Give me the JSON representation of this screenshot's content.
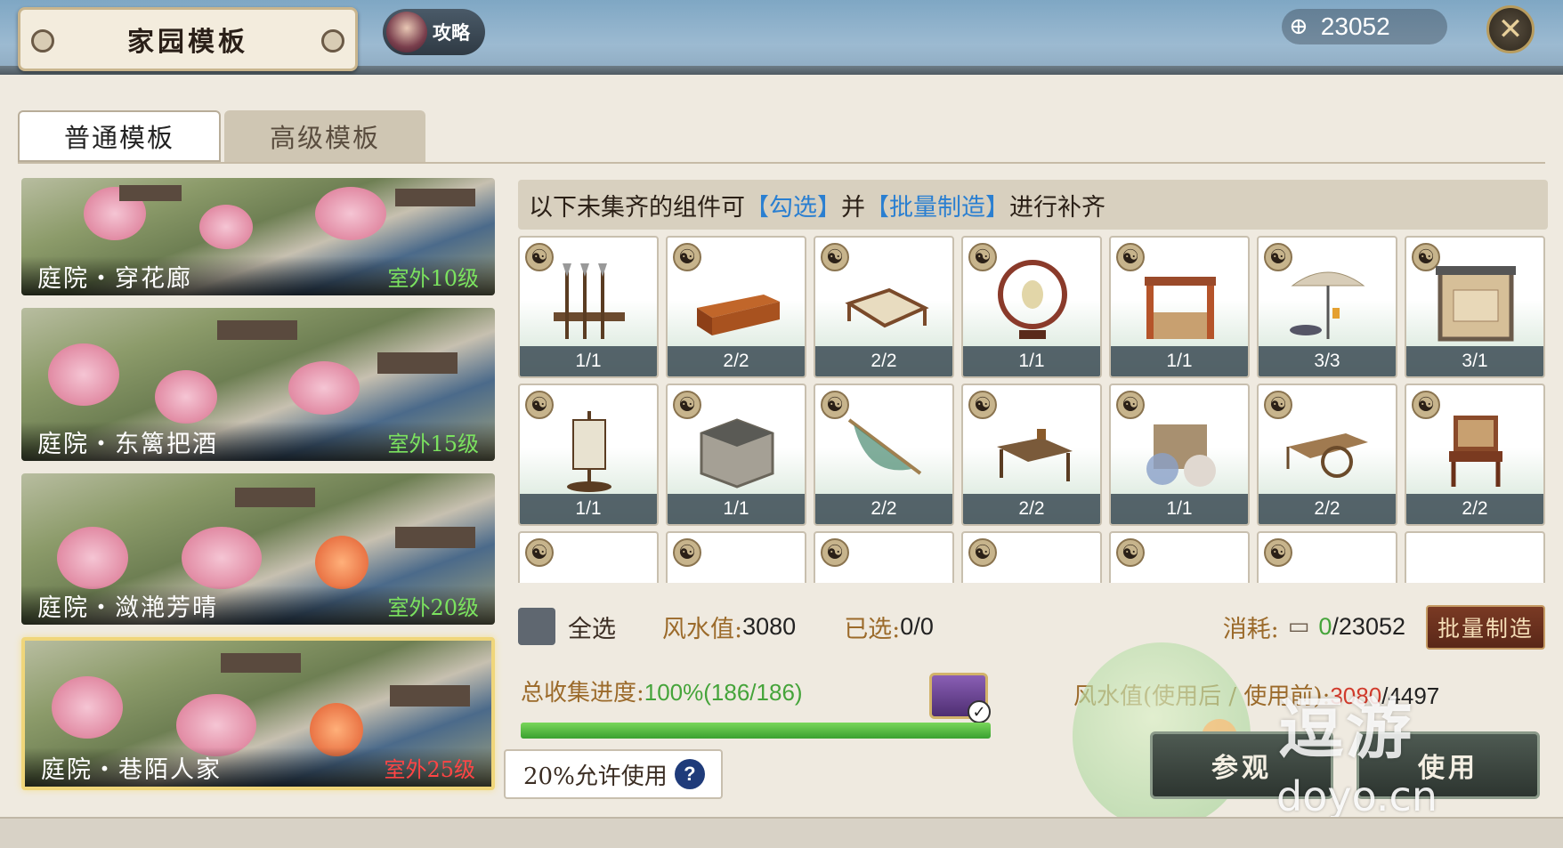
{
  "header": {
    "title": "家园模板",
    "guide_label": "攻略",
    "coins": "23052"
  },
  "tabs": [
    {
      "label": "普通模板"
    },
    {
      "label": "高级模板"
    }
  ],
  "templates": [
    {
      "name": "庭院・穿花廊",
      "level": "室外10级"
    },
    {
      "name": "庭院・东篱把酒",
      "level": "室外15级"
    },
    {
      "name": "庭院・潋滟芳晴",
      "level": "室外20级"
    },
    {
      "name": "庭院・巷陌人家",
      "level": "室外25级"
    }
  ],
  "hint": {
    "pre": "以下未集齐的组件可",
    "link1": "【勾选】",
    "mid": "并",
    "link2": "【批量制造】",
    "post": "进行补齐"
  },
  "items": [
    {
      "count": "1/1",
      "icon": "weapon-rack-icon"
    },
    {
      "count": "2/2",
      "icon": "cabinet-icon"
    },
    {
      "count": "2/2",
      "icon": "bed-icon"
    },
    {
      "count": "1/1",
      "icon": "lantern-ring-icon"
    },
    {
      "count": "1/1",
      "icon": "stall-icon"
    },
    {
      "count": "3/3",
      "icon": "umbrella-icon"
    },
    {
      "count": "3/1",
      "icon": "screen-wall-icon"
    },
    {
      "count": "1/1",
      "icon": "banner-stand-icon"
    },
    {
      "count": "1/1",
      "icon": "stone-well-icon"
    },
    {
      "count": "2/2",
      "icon": "net-icon"
    },
    {
      "count": "2/2",
      "icon": "table-bench-icon"
    },
    {
      "count": "1/1",
      "icon": "umbrella-stall-icon"
    },
    {
      "count": "2/2",
      "icon": "cart-icon"
    },
    {
      "count": "2/2",
      "icon": "armchair-icon"
    }
  ],
  "controls": {
    "select_all": "全选",
    "fengshui_label": "风水值:",
    "fengshui_value": "3080",
    "selected_label": "已选:",
    "selected_value": "0/0",
    "cost_label": "消耗:",
    "cost_used": "0",
    "cost_total": "/23052",
    "batch_button": "批量制造"
  },
  "progress": {
    "label": "总收集进度:",
    "value": "100%(186/186)",
    "fraction": 1.0
  },
  "fengshui_compare": {
    "label": "风水值(使用后 / 使用前):",
    "after": "3080",
    "before": "/4497"
  },
  "allow": {
    "text": "20%允许使用",
    "help": "?"
  },
  "buttons": {
    "visit": "参观",
    "use": "使用"
  },
  "watermark": {
    "text": "逗游",
    "url": "doyo.cn"
  },
  "colors": {
    "accent_blue": "#2a7fd1",
    "green": "#45a43a",
    "red": "#d13b2c"
  }
}
